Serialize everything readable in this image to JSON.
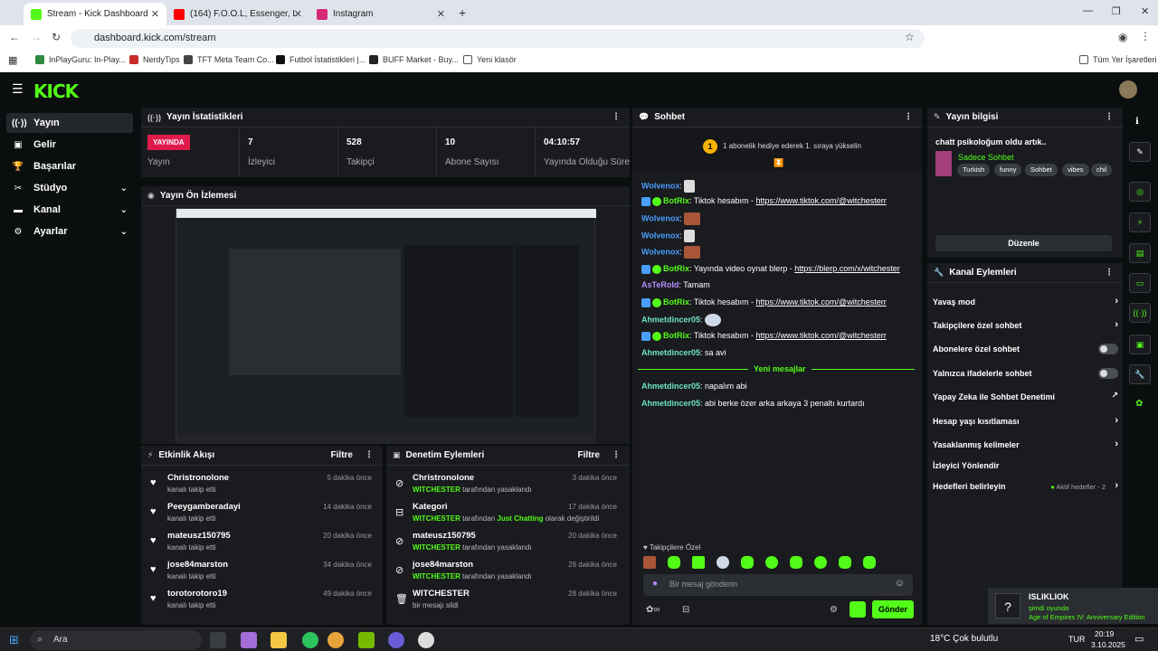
{
  "browser": {
    "tabs": [
      {
        "title": "Stream - Kick Dashboard",
        "active": true
      },
      {
        "title": "(164) F.O.O.L, Essenger, Life Aw...",
        "active": false
      },
      {
        "title": "Instagram",
        "active": false
      }
    ],
    "url": "dashboard.kick.com/stream",
    "bookmarks": [
      "InPlayGuru: In-Play...",
      "NerdyTips",
      "TFT Meta Team Co...",
      "Futbol İstatistikleri |...",
      "BUFF Market - Buy...",
      "Yeni klasör"
    ],
    "all_bookmarks": "Tüm Yer İşaretleri"
  },
  "logo": "KICK",
  "sidebar": {
    "items": [
      {
        "label": "Yayın",
        "icon": "broadcast-icon"
      },
      {
        "label": "Gelir",
        "icon": "money-icon"
      },
      {
        "label": "Başarılar",
        "icon": "trophy-icon"
      },
      {
        "label": "Stüdyo",
        "icon": "studio-icon"
      },
      {
        "label": "Kanal",
        "icon": "channel-icon"
      },
      {
        "label": "Ayarlar",
        "icon": "gear-icon"
      }
    ]
  },
  "stats": {
    "title": "Yayın İstatistikleri",
    "live_badge": "YAYINDA",
    "live_label": "Yayın",
    "items": [
      {
        "value": "7",
        "label": "İzleyici"
      },
      {
        "value": "528",
        "label": "Takipçi"
      },
      {
        "value": "10",
        "label": "Abone Sayısı"
      },
      {
        "value": "04:10:57",
        "label": "Yayında Olduğu Süre"
      }
    ]
  },
  "preview": {
    "title": "Yayın Ön İzlemesi"
  },
  "activity": {
    "title": "Etkinlik Akışı",
    "filter": "Filtre",
    "rows": [
      {
        "name": "Christronolone",
        "sub": "kanalı takip etti",
        "time": "5 dakika önce"
      },
      {
        "name": "Peeygamberadayi",
        "sub": "kanalı takip etti",
        "time": "14 dakika önce"
      },
      {
        "name": "mateusz150795",
        "sub": "kanalı takip etti",
        "time": "20 dakika önce"
      },
      {
        "name": "jose84marston",
        "sub": "kanalı takip etti",
        "time": "34 dakika önce"
      },
      {
        "name": "torotorotoro19",
        "sub": "kanalı takip etti",
        "time": "49 dakika önce"
      }
    ]
  },
  "moderation": {
    "title": "Denetim Eylemleri",
    "filter": "Filtre",
    "rows": [
      {
        "name": "Christronolone",
        "actor": "WITCHESTER",
        "text": "tarafından yasaklandı",
        "time": "3 dakika önce"
      },
      {
        "name": "Kategori",
        "actor": "WITCHESTER",
        "text": "tarafından",
        "extra": "Just Chatting",
        "extra2": "olarak değiştirildi",
        "time": "17 dakika önce"
      },
      {
        "name": "mateusz150795",
        "actor": "WITCHESTER",
        "text": "tarafından yasaklandı",
        "time": "20 dakika önce"
      },
      {
        "name": "jose84marston",
        "actor": "WITCHESTER",
        "text": "tarafından yasaklandı",
        "time": "28 dakika önce"
      },
      {
        "name": "WITCHESTER",
        "actor": "",
        "text": "bir mesajı sildi",
        "time": "28 dakika önce"
      }
    ]
  },
  "chat": {
    "title": "Sohbet",
    "goal": "1 abonelik hediye ederek 1. sıraya yükselin",
    "goal_rank": "1",
    "new_messages": "Yeni mesajlar",
    "messages": [
      {
        "user": "Wolvenox",
        "text": ""
      },
      {
        "user": "BotRix",
        "text": "Tiktok hesabım - ",
        "link": "https://www.tiktok.com/@witchesterr"
      },
      {
        "user": "Wolvenox",
        "text": ""
      },
      {
        "user": "Wolvenox",
        "text": ""
      },
      {
        "user": "BotRix",
        "text": "Yayında video oynat blerp - ",
        "link": "https://blerp.com/x/witchester"
      },
      {
        "user": "AsTeRoId",
        "text": "Tamam"
      },
      {
        "user": "BotRix",
        "text": "Tiktok hesabım - ",
        "link": "https://www.tiktok.com/@witchesterr"
      },
      {
        "user": "Ahmetdincer05",
        "text": ""
      },
      {
        "user": "BotRix",
        "text": "Tiktok hesabım - ",
        "link": "https://www.tiktok.com/@witchesterr"
      },
      {
        "user": "Ahmetdincer05",
        "text": "sa avi"
      },
      {
        "user": "Ahmetdincer05",
        "text": "napalım abi"
      },
      {
        "user": "Ahmetdincer05",
        "text": "abi berke özer arka arkaya 3 penaltı kurtardı"
      }
    ],
    "followers_only": "Takipçilere Özel",
    "placeholder": "Bir mesaj gönderin",
    "send": "Gönder"
  },
  "stream_info": {
    "title": "Yayın bilgisi",
    "stream_title": "chatt psikoloğum oldu artık..",
    "category": "Sadece Sohbet",
    "tags": [
      "Turkish",
      "funny",
      "Sohbet",
      "vibes",
      "chil"
    ],
    "edit": "Düzenle"
  },
  "channel_actions": {
    "title": "Kanal Eylemleri",
    "rows": [
      {
        "label": "Yavaş mod",
        "control": "chevron"
      },
      {
        "label": "Takipçilere özel sohbet",
        "control": "chevron"
      },
      {
        "label": "Abonelere özel sohbet",
        "control": "toggle"
      },
      {
        "label": "Yalnızca ifadelerle sohbet",
        "control": "toggle"
      },
      {
        "label": "Yapay Zeka ile Sohbet Denetimi",
        "control": "external"
      },
      {
        "label": "Hesap yaşı kısıtlaması",
        "control": "chevron"
      },
      {
        "label": "Yasaklanmış kelimeler",
        "control": "chevron"
      },
      {
        "label": "İzleyici Yönlendir",
        "control": "none"
      },
      {
        "label": "Hedefleri belirleyin",
        "control": "chevron",
        "extra": "Aktif hedefler - 2"
      }
    ]
  },
  "notification": {
    "title": "ISLIKLIOK",
    "sub": "şimdi oyunda",
    "game": "Age of Empires IV: Anniversary Edition"
  },
  "taskbar": {
    "search": "Ara",
    "weather": "18°C  Çok bulutlu",
    "lang": "TUR",
    "time": "20:19",
    "date": "3.10.2025"
  },
  "colors": {
    "accent": "#53fc18",
    "live": "#e01b4c",
    "panel": "#191b1f",
    "bg": "#0b0e0f"
  }
}
